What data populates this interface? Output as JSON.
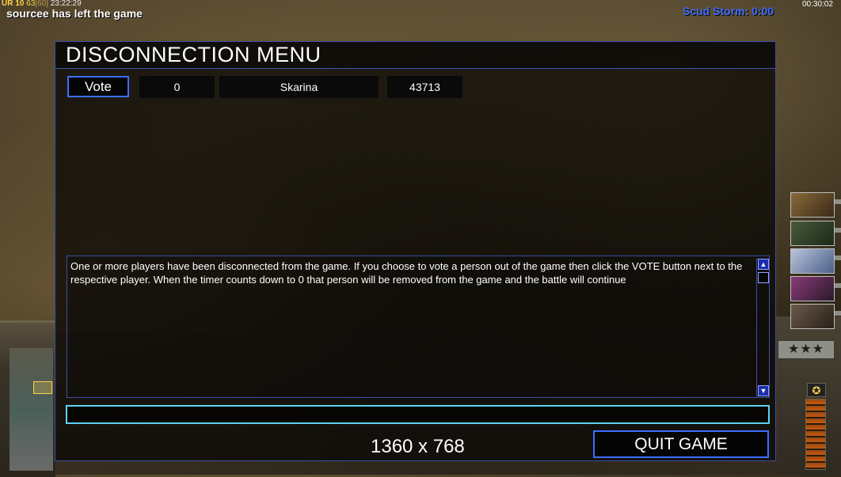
{
  "hud": {
    "build_tag": "UR",
    "fps_a": "10",
    "fps_b": "63",
    "fps_c": "[60]",
    "system_time": "23:22:29",
    "chat_message": "sourcee has left the game",
    "superweapon_timer": "Scud Storm: 0:00",
    "game_clock": "00:30:02"
  },
  "disconnect_menu": {
    "title": "DISCONNECTION MENU",
    "players": [
      {
        "vote_label": "Vote",
        "votes": "0",
        "name": "Skarina",
        "timer": "43713"
      }
    ],
    "message": "One or more players have been disconnected from the game. If you choose to vote a person out of the game then click the VOTE button next to the respective player. When the timer counts down to 0 that person will be removed from the game and the battle will continue",
    "chat_input_value": "",
    "resolution_label": "1360 x 768",
    "quit_label": "QUIT GAME"
  },
  "icons": {
    "scroll_up": "▲",
    "scroll_down": "▼",
    "rank": "✪",
    "stars": "★★★"
  },
  "colors": {
    "panel_border": "#3b4ea8",
    "button_border": "#3d6dff",
    "chat_input_border": "#5fd3f0",
    "superweapon_text": "#3e6bff"
  }
}
